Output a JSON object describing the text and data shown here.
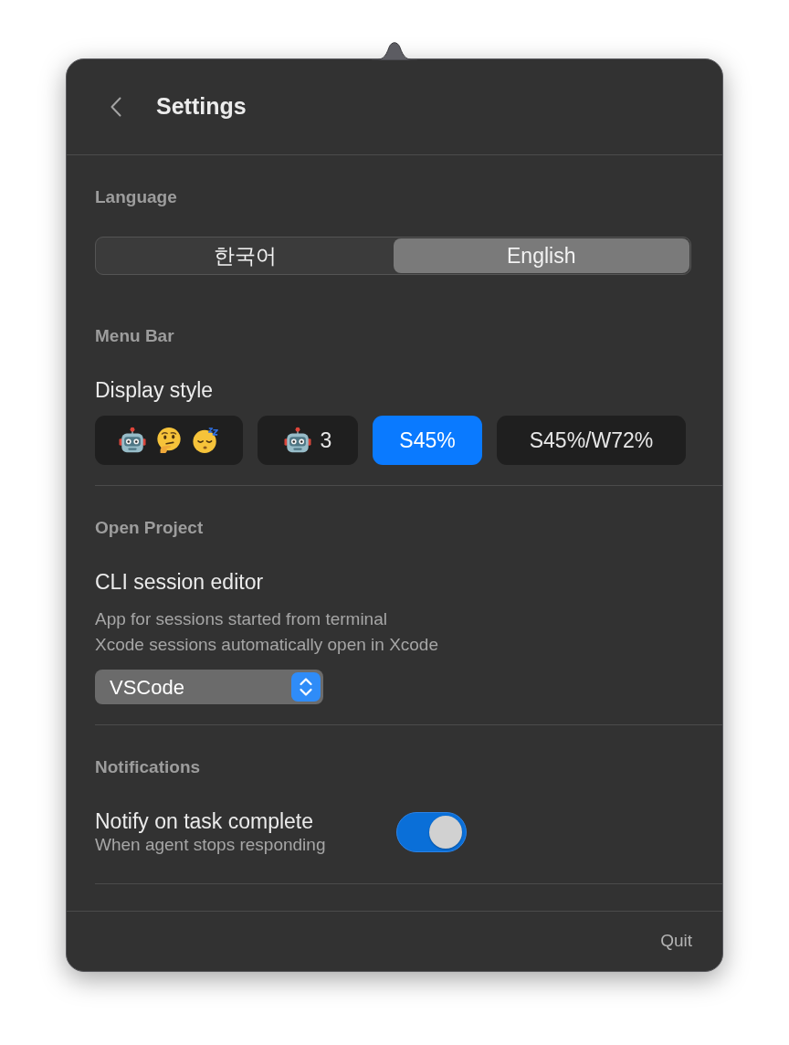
{
  "header": {
    "title": "Settings"
  },
  "language": {
    "heading": "Language",
    "options": [
      {
        "label": "한국어",
        "selected": false
      },
      {
        "label": "English",
        "selected": true
      }
    ]
  },
  "menu_bar": {
    "heading": "Menu Bar",
    "display_style": {
      "label": "Display style",
      "options": [
        {
          "kind": "emoji_states",
          "selected": false
        },
        {
          "kind": "emoji_count",
          "label": "3",
          "selected": false
        },
        {
          "kind": "text",
          "label": "S45%",
          "selected": true
        },
        {
          "kind": "text",
          "label": "S45%/W72%",
          "selected": false
        }
      ]
    }
  },
  "open_project": {
    "heading": "Open Project",
    "cli_session_editor": {
      "label": "CLI session editor",
      "description": [
        "App for sessions started from terminal",
        "Xcode sessions automatically open in Xcode"
      ],
      "value": "VSCode"
    }
  },
  "notifications": {
    "heading": "Notifications",
    "items": [
      {
        "label": "Notify on task complete",
        "description": "When agent stops responding",
        "on": true
      }
    ]
  },
  "footer": {
    "quit": "Quit"
  }
}
